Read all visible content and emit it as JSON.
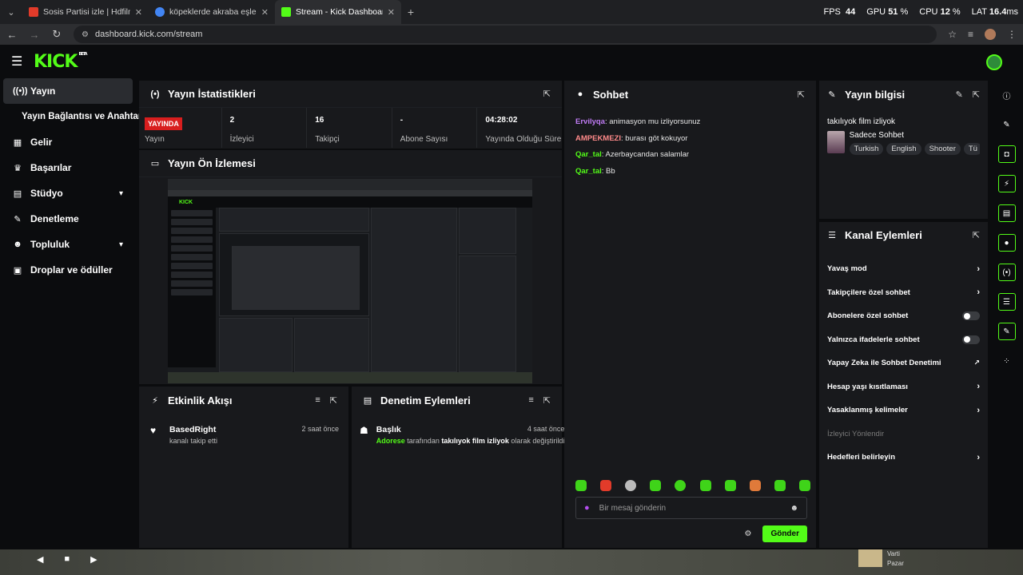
{
  "browser": {
    "tabs": [
      {
        "title": "Sosis Partisi izle | Hdfilmcehennemi",
        "favicon_color": "#e23b2a",
        "active": false
      },
      {
        "title": "köpeklerde akraba eşleşmesi - Google",
        "favicon_color": "#4285f4",
        "active": false
      },
      {
        "title": "Stream - Kick Dashboard",
        "favicon_color": "#53fc18",
        "active": true
      }
    ],
    "url": "dashboard.kick.com/stream"
  },
  "hud": {
    "fps_label": "FPS",
    "fps": "44",
    "gpu_label": "GPU",
    "gpu": "51",
    "gpu_unit": "%",
    "cpu_label": "CPU",
    "cpu": "12",
    "cpu_unit": "%",
    "lat_label": "LAT",
    "lat": "16.4",
    "lat_unit": "ms"
  },
  "header": {
    "logo": "KICK",
    "beta": "BETA"
  },
  "sidebar": {
    "items": [
      {
        "label": "Yayın",
        "icon": "broadcast-icon"
      },
      {
        "label": "Yayın Bağlantısı ve Anahtarı",
        "icon": ""
      },
      {
        "label": "Gelir",
        "icon": "revenue-icon"
      },
      {
        "label": "Başarılar",
        "icon": "trophy-icon"
      },
      {
        "label": "Stüdyo",
        "icon": "studio-icon"
      },
      {
        "label": "Denetleme",
        "icon": "wrench-icon"
      },
      {
        "label": "Topluluk",
        "icon": "community-icon"
      },
      {
        "label": "Droplar ve ödüller",
        "icon": "gift-icon"
      }
    ]
  },
  "stats_panel": {
    "title": "Yayın İstatistikleri",
    "live_badge": "YAYINDA",
    "stats": [
      {
        "value": "",
        "label": "Yayın"
      },
      {
        "value": "2",
        "label": "İzleyici"
      },
      {
        "value": "16",
        "label": "Takipçi"
      },
      {
        "value": "-",
        "label": "Abone Sayısı"
      },
      {
        "value": "04:28:02",
        "label": "Yayında Olduğu Süre"
      }
    ]
  },
  "preview_panel": {
    "title": "Yayın Ön İzlemesi"
  },
  "activity_panel": {
    "title": "Etkinlik Akışı",
    "items": [
      {
        "name": "BasedRight",
        "sub": "kanalı takip etti",
        "time": "2 saat önce"
      }
    ]
  },
  "mod_panel": {
    "title": "Denetim Eylemleri",
    "items": [
      {
        "name": "Başlık",
        "actor": "Adorese",
        "mid": "tarafından",
        "value": "takılıyok film izliyok",
        "end": "olarak değiştirildi",
        "time": "4 saat önce"
      }
    ]
  },
  "chat_panel": {
    "title": "Sohbet",
    "messages": [
      {
        "user": "Ervilyqa",
        "color": "#c07cf5",
        "text": "animasyon mu izliyorsunuz"
      },
      {
        "user": "AMPEKMEZI",
        "color": "#ff8a8a",
        "text": "burası göt kokuyor"
      },
      {
        "user": "Qar_tal",
        "color": "#53fc18",
        "text": "Azerbaycandan salamlar"
      },
      {
        "user": "Qar_tal",
        "color": "#53fc18",
        "text": "Bb"
      }
    ],
    "input_placeholder": "Bir mesaj gönderin",
    "send_label": "Gönder"
  },
  "stream_info": {
    "title": "Yayın bilgisi",
    "stream_title": "takılıyok film izliyok",
    "category": "Sadece Sohbet",
    "tags": [
      "Turkish",
      "English",
      "Shooter",
      "Tü"
    ]
  },
  "channel_actions": {
    "title": "Kanal Eylemleri",
    "items": [
      {
        "label": "Yavaş mod",
        "kind": "arrow"
      },
      {
        "label": "Takipçilere özel sohbet",
        "kind": "arrow"
      },
      {
        "label": "Abonelere özel sohbet",
        "kind": "toggle"
      },
      {
        "label": "Yalnızca ifadelerle sohbet",
        "kind": "toggle"
      },
      {
        "label": "Yapay Zeka ile Sohbet Denetimi",
        "kind": "external"
      },
      {
        "label": "Hesap yaşı kısıtlaması",
        "kind": "arrow"
      },
      {
        "label": "Yasaklanmış kelimeler",
        "kind": "arrow"
      },
      {
        "label": "İzleyici Yönlendir",
        "kind": "disabled"
      },
      {
        "label": "Hedefleri belirleyin",
        "kind": "arrow"
      }
    ]
  },
  "taskbar": {
    "corner_title": "Varti",
    "corner_sub": "Pazar"
  }
}
